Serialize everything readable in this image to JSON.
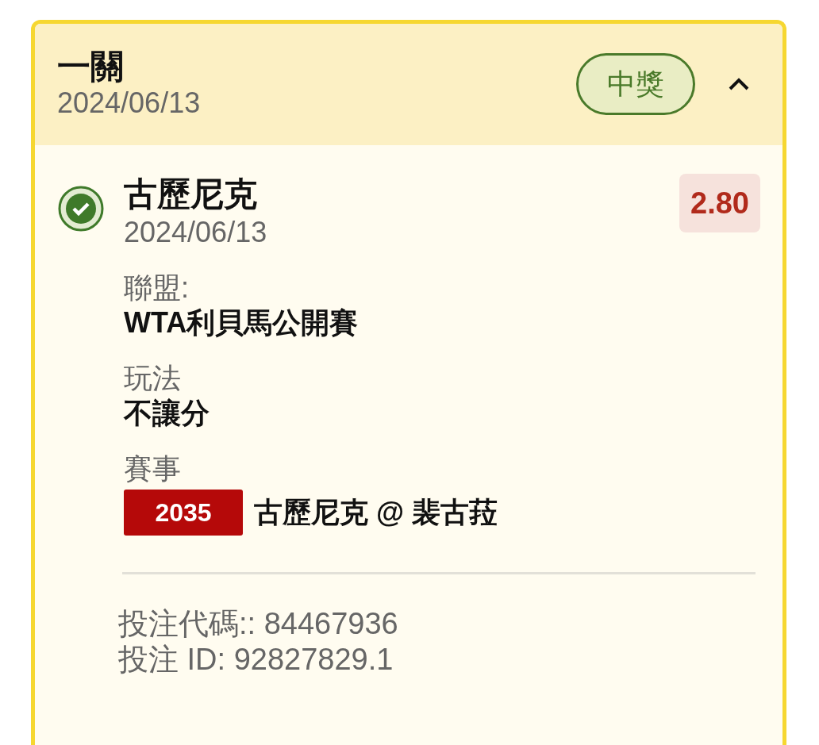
{
  "bet": {
    "type": "一關",
    "date": "2024/06/13",
    "status": "中獎",
    "expanded": true
  },
  "selections": [
    {
      "won": true,
      "name": "古歷尼克",
      "date": "2024/06/13",
      "odds": "2.80",
      "fields": [
        {
          "kind": "text",
          "label": "聯盟:",
          "value": "WTA利貝馬公開賽"
        },
        {
          "kind": "text",
          "label": "玩法",
          "value": "不讓分"
        },
        {
          "kind": "event",
          "label": "賽事",
          "code": "2035",
          "value": "古歷尼克 @ 裴古菈"
        }
      ]
    }
  ],
  "footer": [
    "投注代碼:: 84467936",
    "投注 ID: 92827829.1"
  ]
}
